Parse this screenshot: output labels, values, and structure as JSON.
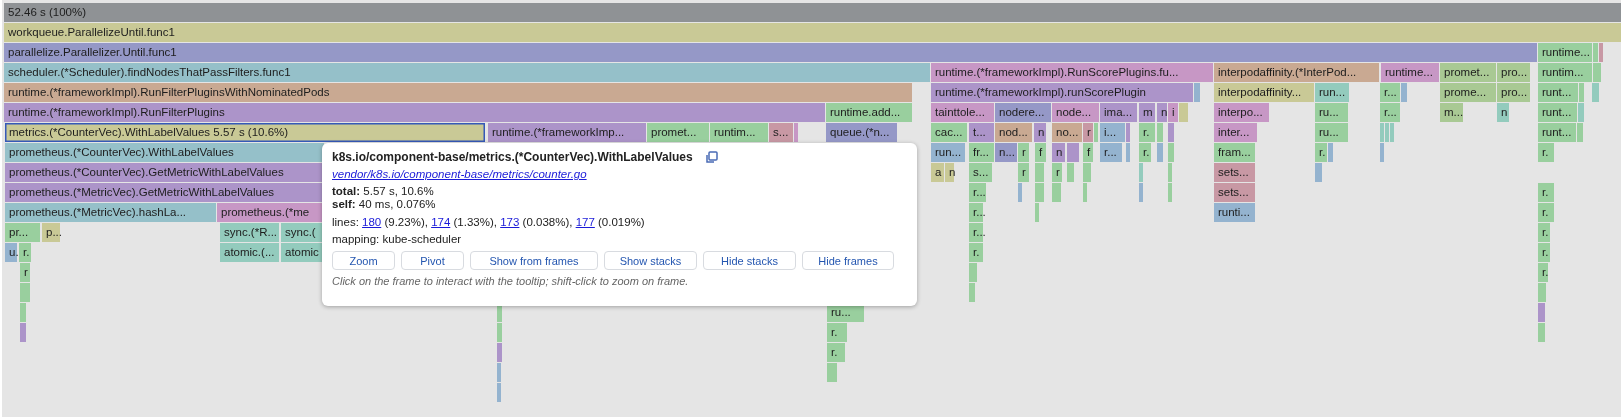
{
  "flame_graph": {
    "rows": [
      {
        "frames": [
          {
            "label": "52.46 s (100%)",
            "color": "#8f9295",
            "selected": false
          }
        ]
      },
      {
        "frames": [
          {
            "label": "workqueue.ParallelizeUntil.func1",
            "color": "#c9c996",
            "selected": false
          }
        ]
      },
      {
        "frames": [
          {
            "label": "parallelize.Parallelizer.Until.func1",
            "color": "#9598c7",
            "selected": false
          },
          {
            "label": "runtime...",
            "color": "#99cf9e",
            "selected": false
          },
          {
            "color": "#99cf9e",
            "selected": false
          },
          {
            "color": "#c898a4",
            "selected": false
          }
        ]
      },
      {
        "frames": [
          {
            "label": "scheduler.(*Scheduler).findNodesThatPassFilters.func1",
            "color": "#95c0c9",
            "selected": false
          },
          {
            "label": "runtime.(*frameworkImpl).RunScorePlugins.fu...",
            "color": "#c797c5",
            "selected": false
          },
          {
            "label": "interpodaffinity.(*InterPod...",
            "color": "#c9a992",
            "selected": false
          },
          {
            "label": "runtime...",
            "color": "#c797c5",
            "selected": false
          },
          {
            "label": "promet...",
            "color": "#a9c994",
            "selected": false
          },
          {
            "label": "pro...",
            "color": "#a9c994",
            "selected": false
          },
          {
            "label": "runtim...",
            "color": "#99cf9e",
            "selected": false
          },
          {
            "color": "#99cf9e",
            "selected": false
          }
        ]
      },
      {
        "frames": [
          {
            "label": "runtime.(*frameworkImpl).RunFilterPluginsWithNominatedPods",
            "color": "#c9a992",
            "selected": false
          },
          {
            "label": "runtime.(*frameworkImpl).runScorePlugin",
            "color": "#ac94c9",
            "selected": false
          },
          {
            "color": "#94b3cf",
            "selected": false
          },
          {
            "label": "interpodaffinity...",
            "color": "#c9c996",
            "selected": false
          },
          {
            "label": "run...",
            "color": "#93cbbd",
            "selected": false
          },
          {
            "label": "r...",
            "color": "#99cf9e",
            "selected": false
          },
          {
            "color": "#94b3cf",
            "selected": false
          },
          {
            "label": "prome...",
            "color": "#a9c994",
            "selected": false
          },
          {
            "label": "pro...",
            "color": "#a9c994",
            "selected": false
          },
          {
            "label": "runt...",
            "color": "#99cf9e",
            "selected": false
          },
          {
            "color": "#99cf9e",
            "selected": false
          },
          {
            "color": "#93cbbd",
            "selected": false
          }
        ]
      },
      {
        "frames": [
          {
            "label": "runtime.(*frameworkImpl).RunFilterPlugins",
            "color": "#ac94c9",
            "selected": false
          },
          {
            "label": "runtime.add...",
            "color": "#99cf9e",
            "selected": false
          },
          {
            "label": "tainttole...",
            "color": "#c797c5",
            "selected": false
          },
          {
            "label": "nodere...",
            "color": "#9598c7",
            "selected": false
          },
          {
            "label": "node...",
            "color": "#c797c5",
            "selected": false
          },
          {
            "label": "ima...",
            "color": "#ac94c9",
            "selected": false
          },
          {
            "label": "m",
            "color": "#ac94c9",
            "selected": false
          },
          {
            "label": "n",
            "color": "#ac94c9",
            "selected": false
          },
          {
            "label": "i",
            "color": "#c797c5",
            "selected": false
          },
          {
            "color": "#c9c996",
            "selected": false
          },
          {
            "label": "interpo...",
            "color": "#c797c5",
            "selected": false
          },
          {
            "label": "ru...",
            "color": "#99cf9e",
            "selected": false
          },
          {
            "label": "r...",
            "color": "#99cf9e",
            "selected": false
          },
          {
            "label": "m...",
            "color": "#a9c994",
            "selected": false
          },
          {
            "label": "n",
            "color": "#93cbbd",
            "selected": false
          },
          {
            "label": "runt...",
            "color": "#99cf9e",
            "selected": false
          },
          {
            "color": "#93cbbd",
            "selected": false
          }
        ]
      },
      {
        "frames": [
          {
            "label": "metrics.(*CounterVec).WithLabelValues 5.57 s (10.6%)",
            "color": "#c9c996",
            "selected": true
          },
          {
            "label": "runtime.(*frameworkImp...",
            "color": "#ac94c9",
            "selected": false
          },
          {
            "label": "promet...",
            "color": "#99cf9e",
            "selected": false
          },
          {
            "label": "runtim...",
            "color": "#99cf9e",
            "selected": false
          },
          {
            "label": "s...",
            "color": "#c898a4",
            "selected": false
          },
          {
            "color": "#c797c5",
            "selected": false
          },
          {
            "label": "queue.(*n...",
            "color": "#9598c7",
            "selected": false
          },
          {
            "label": "cac...",
            "color": "#99cf9e",
            "selected": false
          },
          {
            "label": "t...",
            "color": "#ac94c9",
            "selected": false
          },
          {
            "label": "nod...",
            "color": "#c9a992",
            "selected": false
          },
          {
            "label": "n",
            "color": "#ac94c9",
            "selected": false
          },
          {
            "label": "no...",
            "color": "#c9a992",
            "selected": false
          },
          {
            "label": "r",
            "color": "#c898a4",
            "selected": false
          },
          {
            "color": "#99cf9e",
            "selected": false
          },
          {
            "label": "i...",
            "color": "#94b3cf",
            "selected": false
          },
          {
            "color": "#ac94c9",
            "selected": false
          },
          {
            "label": "r.",
            "color": "#99cf9e",
            "selected": false
          },
          {
            "color": "#99cf9e",
            "selected": false
          },
          {
            "color": "#ac94c9",
            "selected": false
          },
          {
            "label": "inter...",
            "color": "#c797c5",
            "selected": false
          },
          {
            "label": "ru...",
            "color": "#99cf9e",
            "selected": false
          },
          {
            "color": "#93cbbd",
            "selected": false
          },
          {
            "color": "#93cbbd",
            "selected": false
          },
          {
            "color": "#93cbbd",
            "selected": false
          },
          {
            "label": "runt...",
            "color": "#99cf9e",
            "selected": false
          },
          {
            "color": "#99cf9e",
            "selected": false
          }
        ]
      },
      {
        "frames": [
          {
            "label": "prometheus.(*CounterVec).WithLabelValues",
            "color": "#95c0c9",
            "selected": false
          },
          {
            "label": "run...",
            "color": "#94b3cf",
            "selected": false
          },
          {
            "label": "fr...",
            "color": "#99cf9e",
            "selected": false
          },
          {
            "label": "n...",
            "color": "#9598c7",
            "selected": false
          },
          {
            "label": "r",
            "color": "#99cf9e",
            "selected": false
          },
          {
            "label": "f",
            "color": "#99cf9e",
            "selected": false
          },
          {
            "label": "n",
            "color": "#ac94c9",
            "selected": false
          },
          {
            "color": "#ac94c9",
            "selected": false
          },
          {
            "label": "f",
            "color": "#99cf9e",
            "selected": false
          },
          {
            "label": "r...",
            "color": "#94b3cf",
            "selected": false
          },
          {
            "color": "#94b3cf",
            "selected": false
          },
          {
            "label": "r.",
            "color": "#99cf9e",
            "selected": false
          },
          {
            "color": "#94b3cf",
            "selected": false
          },
          {
            "color": "#99cf9e",
            "selected": false
          },
          {
            "label": "fram...",
            "color": "#99cf9e",
            "selected": false
          },
          {
            "label": "r.",
            "color": "#99cf9e",
            "selected": false
          },
          {
            "color": "#94b3cf",
            "selected": false
          },
          {
            "color": "#94b3cf",
            "selected": false
          },
          {
            "label": "r.",
            "color": "#99cf9e",
            "selected": false
          }
        ]
      },
      {
        "frames": [
          {
            "label": "prometheus.(*CounterVec).GetMetricWithLabelValues",
            "color": "#ac94c9",
            "selected": false
          },
          {
            "label": "a",
            "color": "#c9c996",
            "selected": false
          },
          {
            "label": "n",
            "color": "#c9c996",
            "selected": false
          },
          {
            "label": "s...",
            "color": "#99cf9e",
            "selected": false
          },
          {
            "label": "r",
            "color": "#99cf9e",
            "selected": false
          },
          {
            "color": "#99cf9e",
            "selected": false
          },
          {
            "label": "r",
            "color": "#99cf9e",
            "selected": false
          },
          {
            "color": "#99cf9e",
            "selected": false
          },
          {
            "color": "#99cf9e",
            "selected": false
          },
          {
            "color": "#93cbbd",
            "selected": false
          },
          {
            "color": "#99cf9e",
            "selected": false
          },
          {
            "label": "sets...",
            "color": "#c898a4",
            "selected": false
          },
          {
            "color": "#94b3cf",
            "selected": false
          }
        ]
      },
      {
        "frames": [
          {
            "label": "prometheus.(*MetricVec).GetMetricWithLabelValues",
            "color": "#ac94c9",
            "selected": false
          },
          {
            "label": "r...",
            "color": "#99cf9e",
            "selected": false
          },
          {
            "color": "#94b3cf",
            "selected": false
          },
          {
            "color": "#99cf9e",
            "selected": false
          },
          {
            "color": "#99cf9e",
            "selected": false
          },
          {
            "color": "#99cf9e",
            "selected": false
          },
          {
            "color": "#94b3cf",
            "selected": false
          },
          {
            "color": "#99cf9e",
            "selected": false
          },
          {
            "label": "sets...",
            "color": "#c898a4",
            "selected": false
          },
          {
            "label": "r.",
            "color": "#99cf9e",
            "selected": false
          }
        ]
      },
      {
        "frames": [
          {
            "label": "prometheus.(*MetricVec).hashLa...",
            "color": "#95c0c9",
            "selected": false
          },
          {
            "label": "prometheus.(*me",
            "color": "#c797c5",
            "selected": false
          },
          {
            "label": "r...",
            "color": "#99cf9e",
            "selected": false
          },
          {
            "color": "#99cf9e",
            "selected": false
          },
          {
            "label": "runti...",
            "color": "#94b3cf",
            "selected": false
          },
          {
            "label": "r.",
            "color": "#99cf9e",
            "selected": false
          }
        ]
      },
      {
        "frames": [
          {
            "label": "pr...",
            "color": "#99cf9e",
            "selected": false
          },
          {
            "label": "p...",
            "color": "#c9c996",
            "selected": false
          },
          {
            "label": "sync.(*R...",
            "color": "#93cbbd",
            "selected": false
          },
          {
            "label": "sync.(",
            "color": "#93cbbd",
            "selected": false
          },
          {
            "label": "r...",
            "color": "#99cf9e",
            "selected": false
          },
          {
            "label": "r.",
            "color": "#99cf9e",
            "selected": false
          }
        ]
      },
      {
        "frames": [
          {
            "label": "u.",
            "color": "#94b3cf",
            "selected": false
          },
          {
            "label": "r.",
            "color": "#99cf9e",
            "selected": false
          },
          {
            "label": "atomic.(...",
            "color": "#93cbbd",
            "selected": false
          },
          {
            "label": "atomic",
            "color": "#93cbbd",
            "selected": false
          },
          {
            "label": "r.",
            "color": "#99cf9e",
            "selected": false
          },
          {
            "label": "r.",
            "color": "#99cf9e",
            "selected": false
          }
        ]
      },
      {
        "frames": [
          {
            "label": "r",
            "color": "#99cf9e",
            "selected": false
          },
          {
            "color": "#99cf9e",
            "selected": false
          },
          {
            "label": "r.",
            "color": "#99cf9e",
            "selected": false
          }
        ]
      },
      {
        "frames": [
          {
            "color": "#99cf9e",
            "selected": false
          },
          {
            "color": "#99cf9e",
            "selected": false
          },
          {
            "color": "#99cf9e",
            "selected": false
          }
        ]
      },
      {
        "frames": [
          {
            "color": "#99cf9e",
            "selected": false
          },
          {
            "color": "#99cf9e",
            "selected": false
          },
          {
            "label": "ru...",
            "color": "#99cf9e",
            "selected": false
          },
          {
            "color": "#ac94c9",
            "selected": false
          }
        ]
      },
      {
        "frames": [
          {
            "color": "#ac94c9",
            "selected": false
          },
          {
            "color": "#99cf9e",
            "selected": false
          },
          {
            "label": "r.",
            "color": "#99cf9e",
            "selected": false
          },
          {
            "color": "#99cf9e",
            "selected": false
          }
        ]
      },
      {
        "frames": [
          {
            "color": "#ac94c9",
            "selected": false
          },
          {
            "label": "r.",
            "color": "#99cf9e",
            "selected": false
          }
        ]
      },
      {
        "frames": [
          {
            "color": "#94b3cf",
            "selected": false
          },
          {
            "color": "#99cf9e",
            "selected": false
          }
        ]
      },
      {
        "frames": [
          {
            "color": "#94b3cf",
            "selected": false
          }
        ]
      }
    ]
  },
  "tooltip": {
    "title": "k8s.io/component-base/metrics.(*CounterVec).WithLabelValues",
    "file": "vendor/k8s.io/component-base/metrics/counter.go",
    "stats": [
      "**total:** 5.57 s, 10.6%",
      "**self:** 40 ms, 0.076%"
    ],
    "lines_label": "lines:",
    "lines": [
      {
        "line": "180",
        "share": "(9.23%),"
      },
      {
        "line": "174",
        "share": "(1.33%),"
      },
      {
        "line": "173",
        "share": "(0.038%),"
      },
      {
        "line": "177",
        "share": "(0.019%)"
      }
    ],
    "mapping": "mapping: kube-scheduler",
    "buttons": [
      "Zoom",
      "Pivot",
      "Show from frames",
      "Show stacks",
      "Hide stacks",
      "Hide frames"
    ],
    "hint": "Click on the frame to interact with the tooltip; shift-click to zoom on frame."
  }
}
